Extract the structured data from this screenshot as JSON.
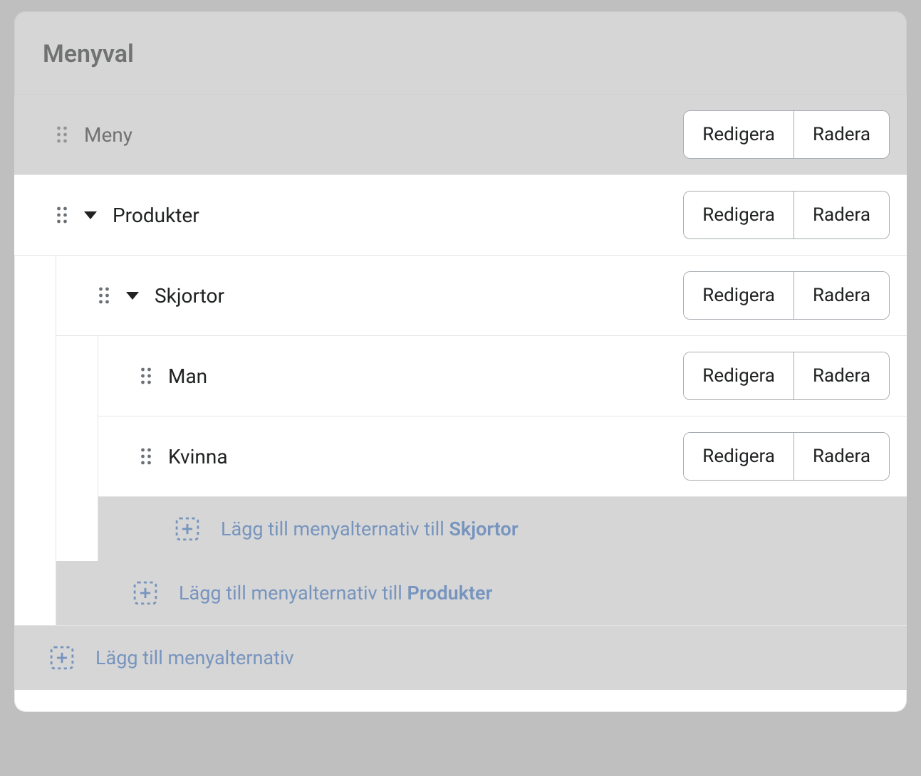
{
  "header": {
    "title": "Menyval"
  },
  "buttons": {
    "edit": "Redigera",
    "delete": "Radera"
  },
  "add": {
    "prefix": "Lägg till menyalternativ till ",
    "root": "Lägg till menyalternativ"
  },
  "items": {
    "root": {
      "label": "Meny"
    },
    "level1": {
      "label": "Produkter",
      "add_target": "Produkter",
      "level2": {
        "label": "Skjortor",
        "add_target": "Skjortor",
        "children": [
          {
            "label": "Man"
          },
          {
            "label": "Kvinna"
          }
        ]
      }
    }
  }
}
